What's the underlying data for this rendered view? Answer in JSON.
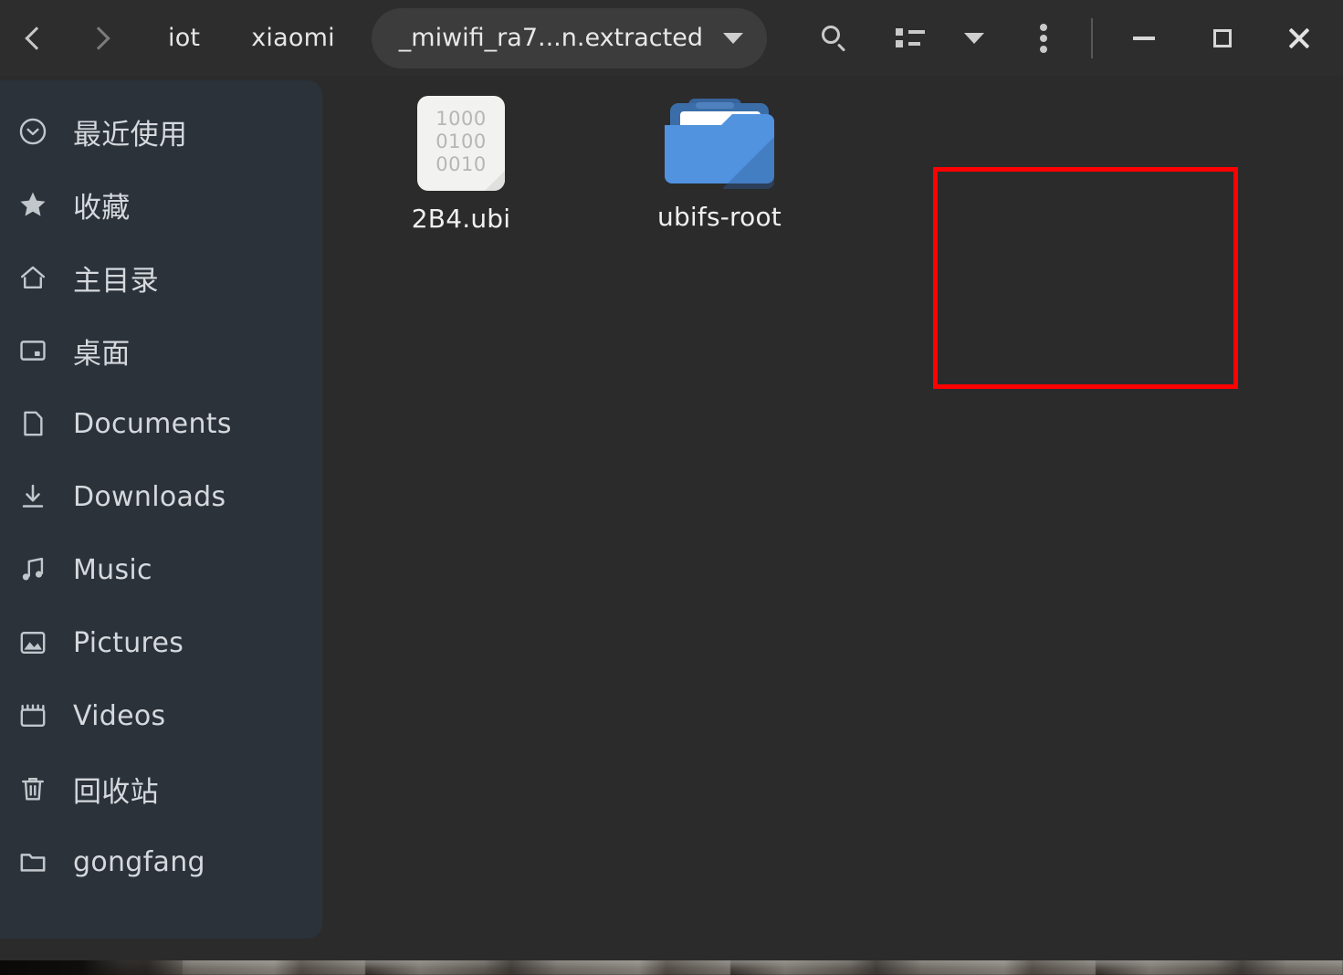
{
  "window": {
    "app": "file-manager",
    "background_color": "#2b2b2b",
    "header_color": "#2d2d2d"
  },
  "header": {
    "nav": {
      "back_icon": "chevron-left-icon",
      "forward_icon": "chevron-right-icon"
    },
    "breadcrumbs": [
      {
        "label": "iot",
        "active": false
      },
      {
        "label": "xiaomi",
        "active": false
      }
    ],
    "path_pill": {
      "label": "_miwifi_ra7...n.extracted",
      "dropdown_icon": "chevron-down-icon"
    },
    "actions": [
      {
        "name": "search-button",
        "icon": "search-icon"
      },
      {
        "name": "view-mode-button",
        "icon": "list-view-icon"
      },
      {
        "name": "sort-button",
        "icon": "chevron-down-icon"
      },
      {
        "name": "menu-button",
        "icon": "three-dots-vertical-icon"
      }
    ],
    "window_controls": [
      {
        "name": "minimize-button",
        "icon": "minimize-icon"
      },
      {
        "name": "maximize-button",
        "icon": "maximize-icon"
      },
      {
        "name": "close-button",
        "icon": "close-icon"
      }
    ]
  },
  "sidebar": {
    "background_color": "#2c323a",
    "items": [
      {
        "label": "最近使用",
        "icon": "clock-recent-icon",
        "cjk": true
      },
      {
        "label": "收藏",
        "icon": "star-icon",
        "cjk": true
      },
      {
        "label": "主目录",
        "icon": "home-icon",
        "cjk": true
      },
      {
        "label": "桌面",
        "icon": "desktop-icon",
        "cjk": true
      },
      {
        "label": "Documents",
        "icon": "document-icon",
        "cjk": false
      },
      {
        "label": "Downloads",
        "icon": "download-icon",
        "cjk": false
      },
      {
        "label": "Music",
        "icon": "music-note-icon",
        "cjk": false
      },
      {
        "label": "Pictures",
        "icon": "image-icon",
        "cjk": false
      },
      {
        "label": "Videos",
        "icon": "video-icon",
        "cjk": false
      },
      {
        "label": "回收站",
        "icon": "trash-icon",
        "cjk": true
      },
      {
        "label": "gongfang",
        "icon": "folder-icon",
        "cjk": false
      }
    ]
  },
  "main": {
    "items": [
      {
        "name": "2B4.ubi",
        "type": "file",
        "icon": "binary-file-icon",
        "icon_text": [
          "1000",
          "0100",
          "0010"
        ],
        "selected": false
      },
      {
        "name": "ubifs-root",
        "type": "folder",
        "icon": "folder-icon",
        "selected": false,
        "highlighted": true
      }
    ]
  },
  "annotation": {
    "selection_rect": {
      "color": "#ff0000",
      "target": "ubifs-root"
    }
  }
}
